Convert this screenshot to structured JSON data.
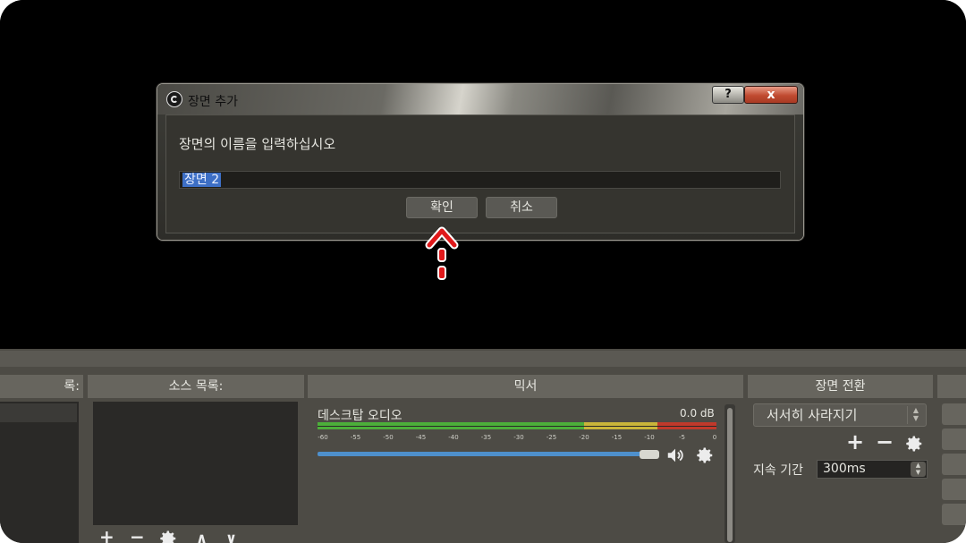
{
  "dialog": {
    "title": "장면 추가",
    "help_label": "?",
    "close_label": "x",
    "prompt": "장면의 이름을 입력하십시오",
    "input_value": "장면 2",
    "ok_label": "확인",
    "cancel_label": "취소"
  },
  "docks": {
    "scenes_header": "록:",
    "sources_header": "소스 목록:",
    "mixer_header": "믹서",
    "transitions_header": "장면 전환"
  },
  "sources": {
    "add_label": "+",
    "remove_label": "−",
    "up_label": "∧",
    "down_label": "∨"
  },
  "mixer": {
    "channel_name": "데스크탑 오디오",
    "level": "0.0 dB",
    "tick_labels": [
      "-60",
      "-55",
      "-50",
      "-45",
      "-40",
      "-35",
      "-30",
      "-25",
      "-20",
      "-15",
      "-10",
      "-5",
      "0"
    ],
    "volume_fraction": 1.0
  },
  "transitions": {
    "selected": "서서히 사라지기",
    "add_label": "+",
    "remove_label": "−",
    "duration_label": "지속 기간",
    "duration_value": "300ms"
  },
  "colors": {
    "meter_green": "#4caf3a",
    "meter_yellow": "#c9b53a",
    "meter_red": "#c0392b",
    "annotation_red": "#e0191b",
    "selection_blue": "#3d6fc6"
  }
}
